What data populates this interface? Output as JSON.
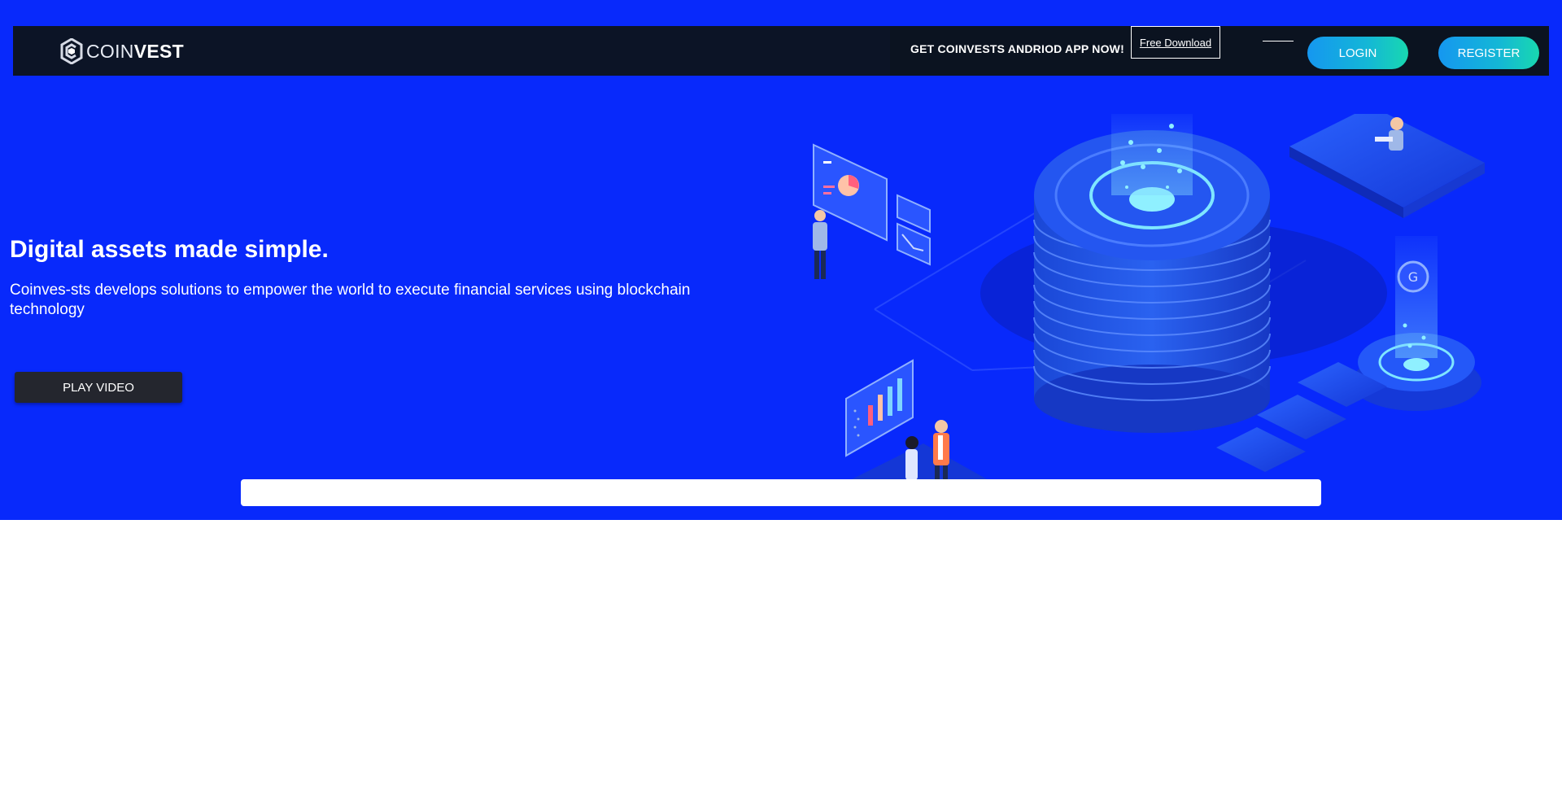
{
  "brand": {
    "name_thin": "COIN",
    "name_bold": "VEST",
    "icon": "coinvest-logo-icon"
  },
  "nav": {
    "promo_text": "GET COINVESTS ANDRIOD APP NOW!",
    "free_download": "Free Download",
    "login": "LOGIN",
    "register": "REGISTER"
  },
  "hero": {
    "headline": "Digital assets made simple.",
    "subheadline": "Coinves-sts develops solutions to empower the world to execute financial services using blockchain technology",
    "play_video": "PLAY VIDEO"
  },
  "colors": {
    "hero_background": "#0829fb",
    "navbar_background": "#0c1426",
    "button_gradient_start": "#1597f0",
    "button_gradient_end": "#18d8b0",
    "play_button": "#24262e"
  }
}
